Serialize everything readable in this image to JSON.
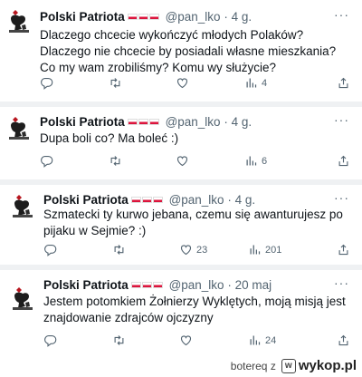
{
  "tweets": [
    {
      "name": "Polski Patriota",
      "handle": "@pan_lko",
      "dot": "·",
      "time": "4 g.",
      "text": "Dlaczego chcecie wykończyć młodych Polaków? Dlaczego nie chcecie by posiadali własne mieszkania? Co my wam zrobiliśmy? Komu wy służycie?",
      "views": "4",
      "replies": "",
      "likes": ""
    },
    {
      "name": "Polski Patriota",
      "handle": "@pan_lko",
      "dot": "·",
      "time": "4 g.",
      "text": "Dupa boli co? Ma boleć :)",
      "views": "6",
      "replies": "",
      "likes": ""
    },
    {
      "name": "Polski Patriota",
      "handle": "@pan_lko",
      "dot": "·",
      "time": "4 g.",
      "text": "Szmatecki ty kurwo jebana, czemu się awanturujesz po pijaku w Sejmie? :)",
      "views": "201",
      "replies": "",
      "likes": "23"
    },
    {
      "name": "Polski Patriota",
      "handle": "@pan_lko",
      "dot": "·",
      "time": "20 maj",
      "text": "Jestem potomkiem Żołnierzy Wyklętych, moją misją jest znajdowanie zdrajców ojczyzny",
      "views": "24",
      "replies": "",
      "likes": ""
    }
  ],
  "more_label": "···",
  "footer": {
    "user": "botereq",
    "via": "z",
    "site": "wykop.pl",
    "logo_letter": "w"
  },
  "colors": {
    "muted": "#536471",
    "flag_red": "#dc143c",
    "separator": "#eff1f3"
  },
  "icons": [
    "reply-icon",
    "retweet-icon",
    "like-icon",
    "views-icon",
    "share-icon"
  ]
}
